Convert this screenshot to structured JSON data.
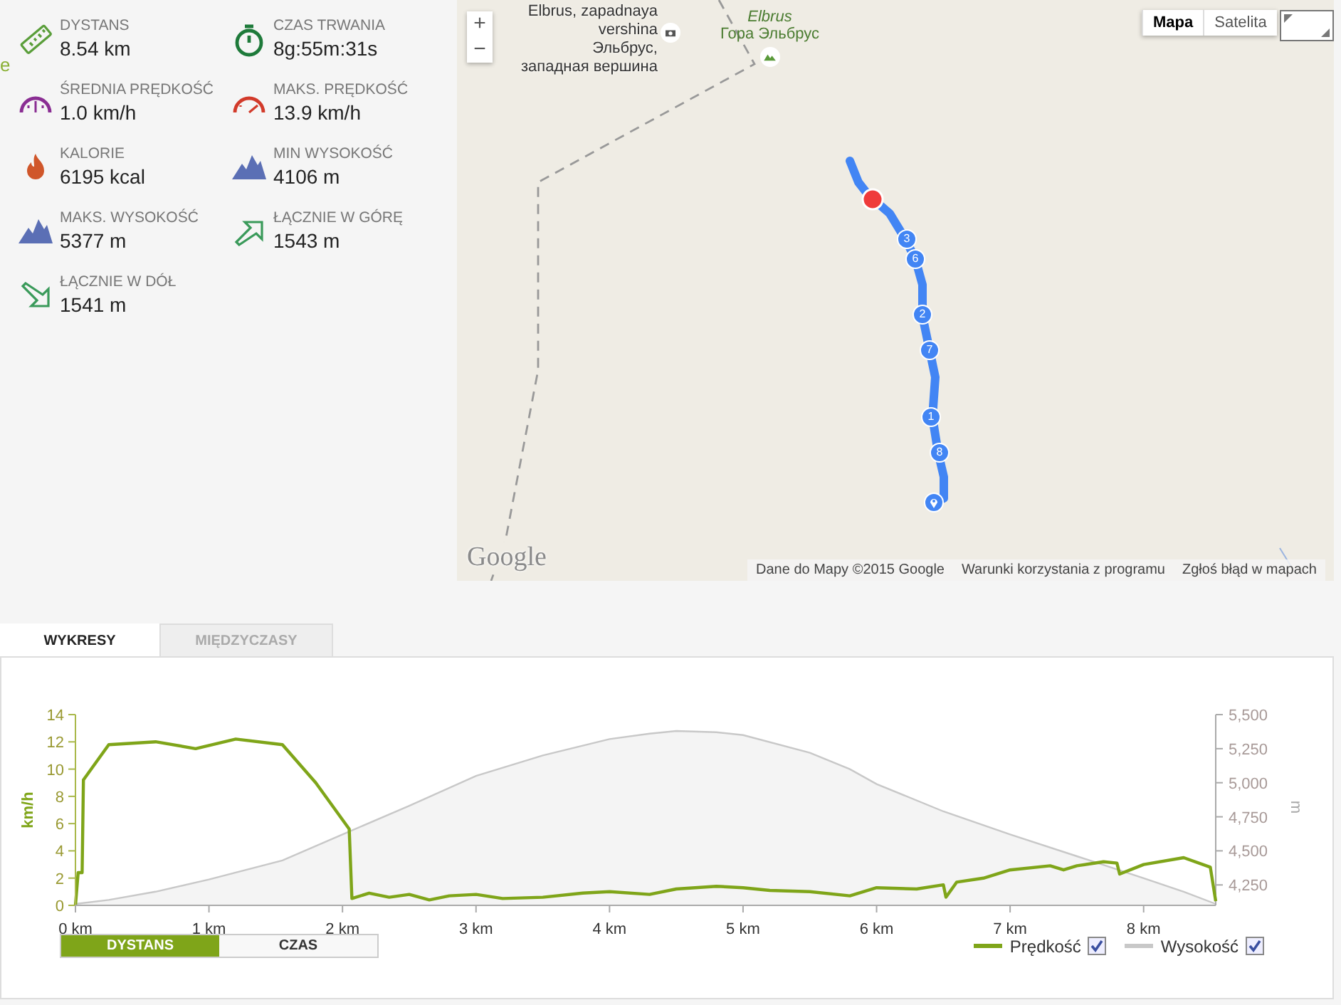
{
  "edge_text": "e",
  "stats": [
    {
      "kind": "ruler",
      "label": "DYSTANS",
      "value": "8.54 km"
    },
    {
      "kind": "stopwatch",
      "label": "CZAS TRWANIA",
      "value": "8g:55m:31s"
    },
    {
      "kind": "gauge-avg",
      "label": "ŚREDNIA PRĘDKOŚĆ",
      "value": "1.0 km/h"
    },
    {
      "kind": "gauge-max",
      "label": "MAKS. PRĘDKOŚĆ",
      "value": "13.9 km/h"
    },
    {
      "kind": "flame",
      "label": "KALORIE",
      "value": "6195 kcal"
    },
    {
      "kind": "mountains",
      "label": "MIN WYSOKOŚĆ",
      "value": "4106 m"
    },
    {
      "kind": "mountains",
      "label": "MAKS. WYSOKOŚĆ",
      "value": "5377 m"
    },
    {
      "kind": "arrow-up",
      "label": "ŁĄCZNIE W GÓRĘ",
      "value": "1543 m"
    },
    {
      "kind": "arrow-down",
      "label": "ŁĄCZNIE W DÓŁ",
      "value": "1541 m"
    }
  ],
  "map": {
    "zoom_in": "+",
    "zoom_out": "−",
    "places": [
      {
        "kind": "photo",
        "lines": [
          "Elbrus, zapadnaya",
          "vershina",
          "Эльбрус,",
          "западная вершина"
        ]
      },
      {
        "kind": "peak",
        "italic": "Elbrus",
        "lines": [
          "Гора Эльбрус"
        ]
      }
    ],
    "map_types": [
      {
        "label": "Mapa",
        "selected": true
      },
      {
        "label": "Satelita",
        "selected": false
      }
    ],
    "markers": [
      {
        "kind": "number",
        "label": "3"
      },
      {
        "kind": "number",
        "label": "6"
      },
      {
        "kind": "number",
        "label": "2"
      },
      {
        "kind": "number",
        "label": "7"
      },
      {
        "kind": "number",
        "label": "1"
      },
      {
        "kind": "number",
        "label": "8"
      },
      {
        "kind": "pin"
      },
      {
        "kind": "position"
      }
    ],
    "logo": "Google",
    "footer": [
      "Dane do Mapy ©2015 Google",
      "Warunki korzystania z programu",
      "Zgłoś błąd w mapach"
    ]
  },
  "tabs": [
    {
      "label": "WYKRESY",
      "selected": true
    },
    {
      "label": "MIĘDZYCZASY",
      "selected": false
    }
  ],
  "chart": {
    "chart_data": {
      "type": "line",
      "ylabel": "km/h",
      "x": [
        0,
        0.02,
        0.05,
        0.06,
        0.25,
        0.6,
        0.9,
        1.2,
        1.55,
        1.8,
        2.05,
        2.07,
        2.2,
        2.35,
        2.5,
        2.65,
        2.8,
        3.0,
        3.2,
        3.5,
        3.8,
        4.0,
        4.3,
        4.5,
        4.8,
        5.0,
        5.2,
        5.5,
        5.8,
        6.0,
        6.3,
        6.5,
        6.52,
        6.6,
        6.8,
        7.0,
        7.3,
        7.4,
        7.5,
        7.7,
        7.8,
        7.82,
        8.0,
        8.3,
        8.5,
        8.54
      ],
      "series": [
        {
          "name": "Prędkość",
          "color": "#7fa519",
          "values": [
            0,
            2.4,
            2.4,
            9.2,
            11.8,
            12.0,
            11.5,
            12.2,
            11.8,
            9.0,
            5.6,
            0.5,
            0.9,
            0.6,
            0.8,
            0.4,
            0.7,
            0.8,
            0.5,
            0.6,
            0.9,
            1.0,
            0.8,
            1.2,
            1.4,
            1.3,
            1.1,
            1.0,
            0.7,
            1.3,
            1.2,
            1.5,
            0.6,
            1.7,
            2.0,
            2.6,
            2.9,
            2.6,
            2.9,
            3.2,
            3.1,
            2.3,
            3.0,
            3.5,
            2.8,
            0.3
          ]
        }
      ],
      "xlim": [
        0,
        8.54
      ],
      "ylim": [
        0,
        14
      ],
      "xticks": [
        {
          "value": 0,
          "label": "0 km"
        },
        {
          "value": 1,
          "label": "1 km"
        },
        {
          "value": 2,
          "label": "2 km"
        },
        {
          "value": 3,
          "label": "3 km"
        },
        {
          "value": 4,
          "label": "4 km"
        },
        {
          "value": 5,
          "label": "5 km"
        },
        {
          "value": 6,
          "label": "6 km"
        },
        {
          "value": 7,
          "label": "7 km"
        },
        {
          "value": 8,
          "label": "8 km"
        }
      ],
      "yticks": [
        0,
        2,
        4,
        6,
        8,
        10,
        12,
        14
      ]
    },
    "elevation_chart": {
      "chart_data": {
        "type": "area",
        "ylabel": "m",
        "x": [
          0,
          0.25,
          0.6,
          1.0,
          1.55,
          2.0,
          2.5,
          3.0,
          3.5,
          4.0,
          4.3,
          4.5,
          4.8,
          5.0,
          5.5,
          5.8,
          6.0,
          6.5,
          7.0,
          7.5,
          8.0,
          8.3,
          8.54
        ],
        "series": [
          {
            "name": "Wysokość",
            "color": "#c8c8c8",
            "values": [
              4110,
              4140,
              4200,
              4290,
              4430,
              4620,
              4830,
              5050,
              5200,
              5320,
              5360,
              5380,
              5370,
              5350,
              5220,
              5100,
              4990,
              4790,
              4620,
              4460,
              4300,
              4200,
              4110
            ]
          }
        ],
        "xlim": [
          0,
          8.54
        ],
        "ylim": [
          4100,
          5500
        ],
        "yticks": [
          {
            "value": 4250,
            "label": "4,250"
          },
          {
            "value": 4500,
            "label": "4,500"
          },
          {
            "value": 4750,
            "label": "4,750"
          },
          {
            "value": 5000,
            "label": "5,000"
          },
          {
            "value": 5250,
            "label": "5,250"
          },
          {
            "value": 5500,
            "label": "5,500"
          }
        ]
      }
    },
    "axis_modes": [
      {
        "label": "DYSTANS",
        "selected": true
      },
      {
        "label": "CZAS",
        "selected": false
      }
    ],
    "legend": [
      {
        "checked": true
      },
      {
        "checked": true
      }
    ]
  }
}
